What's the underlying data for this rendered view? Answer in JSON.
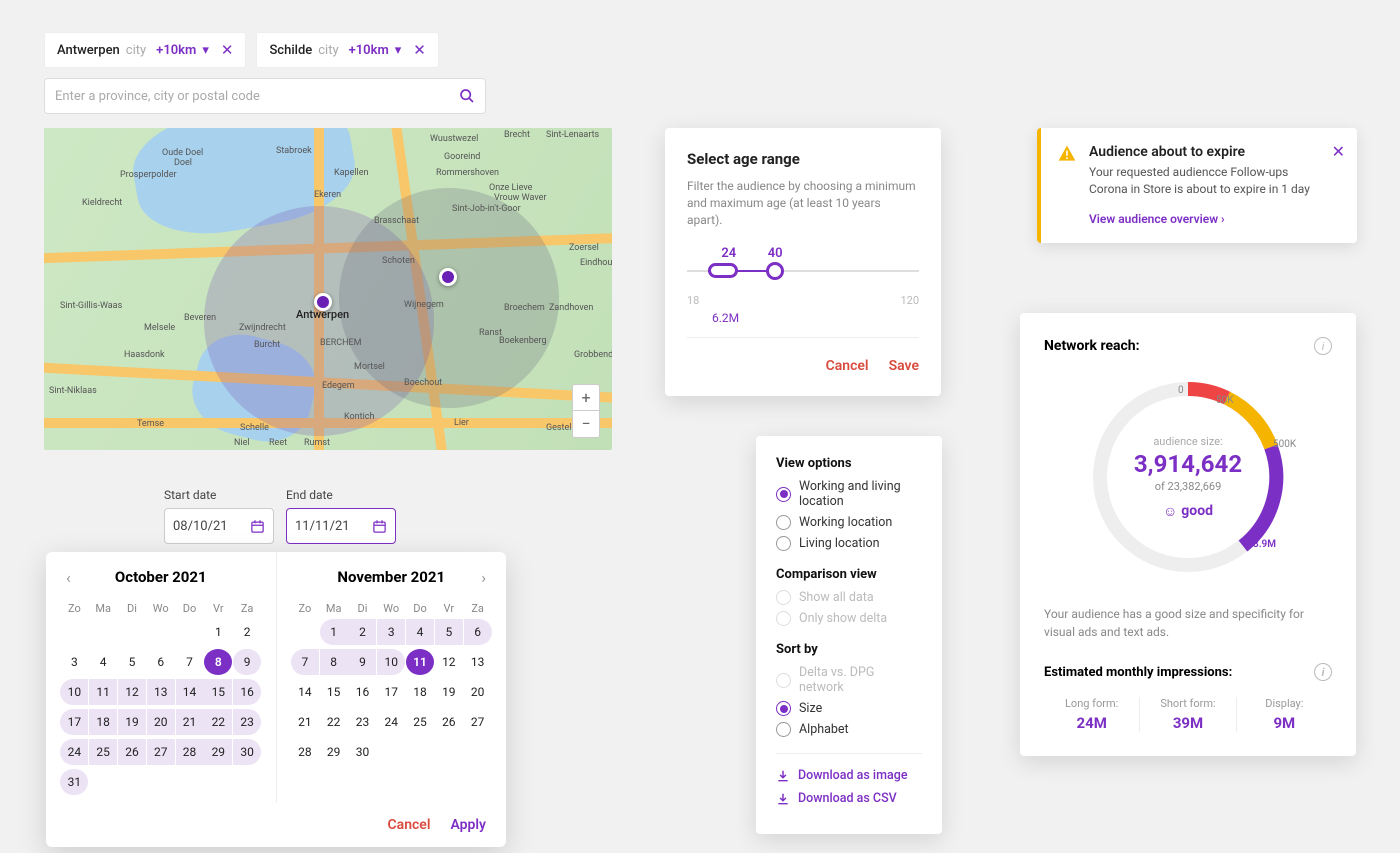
{
  "chips": [
    {
      "name": "Antwerpen",
      "type": "city",
      "radius": "+10km"
    },
    {
      "name": "Schilde",
      "type": "city",
      "radius": "+10km"
    }
  ],
  "search": {
    "placeholder": "Enter a province, city or postal code"
  },
  "map": {
    "labels": [
      "Brecht",
      "Sint-Lenaarts",
      "Brasschaat",
      "Wijnegem",
      "Ranst",
      "Edegem",
      "Mortsel",
      "Kontich",
      "Lier",
      "Gestel",
      "Zoersel",
      "Zandhoven",
      "Boechout",
      "Schoten",
      "BERCHEM",
      "Schelle",
      "Niel",
      "Reet",
      "Rumst",
      "Temse",
      "Haasdonk",
      "Zwijndrecht",
      "Burcht",
      "Beveren",
      "Sint-Niklaas",
      "Melsele",
      "Sint-Gillis-Waas",
      "Wuustwezel",
      "Gooreind",
      "Rommershoven",
      "Sint-Job-in't-Goor",
      "Stabroek",
      "Kapellen",
      "Ekeren",
      "Oude Doel",
      "Doel",
      "Prosperpolder",
      "Kieldrecht",
      "Onze Lieve",
      "Vrouw Waver",
      "Eindhout",
      "Grobbendonk",
      "Boekenberg",
      "Broechem"
    ],
    "main_city": "Antwerpen",
    "markers": [
      {
        "city": "Antwerpen",
        "radius_km": 10
      },
      {
        "city": "Schilde",
        "radius_km": 10
      }
    ]
  },
  "dates": {
    "start_label": "Start date",
    "end_label": "End date",
    "start_value": "08/10/21",
    "end_value": "11/11/21"
  },
  "calendar": {
    "prev_month": "October 2021",
    "next_month": "November 2021",
    "dow": [
      "Zo",
      "Ma",
      "Di",
      "Wo",
      "Do",
      "Vr",
      "Za"
    ],
    "oct_days": [
      [
        "",
        "",
        "",
        "",
        "",
        "1",
        "2"
      ],
      [
        "3",
        "4",
        "5",
        "6",
        "7",
        "8",
        "9"
      ],
      [
        "10",
        "11",
        "12",
        "13",
        "14",
        "15",
        "16"
      ],
      [
        "17",
        "18",
        "19",
        "20",
        "21",
        "22",
        "23"
      ],
      [
        "24",
        "25",
        "26",
        "27",
        "28",
        "29",
        "30"
      ],
      [
        "31",
        "",
        "",
        "",
        "",
        "",
        ""
      ]
    ],
    "nov_days": [
      [
        "",
        "1",
        "2",
        "3",
        "4",
        "5",
        "6"
      ],
      [
        "7",
        "8",
        "9",
        "10",
        "11",
        "12",
        "13"
      ],
      [
        "14",
        "15",
        "16",
        "17",
        "18",
        "19",
        "20"
      ],
      [
        "21",
        "22",
        "23",
        "24",
        "25",
        "26",
        "27"
      ],
      [
        "28",
        "29",
        "30",
        "",
        "",
        "",
        ""
      ]
    ],
    "selected_start": 8,
    "selected_end": 11,
    "cancel": "Cancel",
    "apply": "Apply"
  },
  "age": {
    "title": "Select age range",
    "description": "Filter the audience by choosing a minimum and maximum age (at least 10 years apart).",
    "min": "24",
    "max": "40",
    "lower_bound": "18",
    "upper_bound": "120",
    "count": "6.2M",
    "cancel": "Cancel",
    "save": "Save"
  },
  "notification": {
    "title": "Audience about to expire",
    "body": "Your requested audiencce Follow-ups Corona in Store is about to expire in 1 day",
    "link": "View audience overview"
  },
  "view_options": {
    "group1_title": "View options",
    "group1": [
      "Working and living location",
      "Working location",
      "Living location"
    ],
    "group1_selected": 0,
    "group2_title": "Comparison view",
    "group2": [
      "Show all data",
      "Only show delta"
    ],
    "group3_title": "Sort by",
    "group3": [
      "Delta vs. DPG network",
      "Size",
      "Alphabet"
    ],
    "group3_selected": 1,
    "download_image": "Download as image",
    "download_csv": "Download as CSV"
  },
  "reach": {
    "title": "Network reach:",
    "gauge_labels": {
      "zero": "0",
      "fifty": "50K",
      "fivehundred": "500K",
      "marker": "3.9M"
    },
    "center_label": "audience size:",
    "value": "3,914,642",
    "of": "of 23,382,669",
    "quality": "good",
    "description": "Your audience has a good size and specificity for visual ads and text ads.",
    "impressions_title": "Estimated monthly impressions:",
    "impressions": [
      {
        "k": "Long form:",
        "v": "24M"
      },
      {
        "k": "Short form:",
        "v": "39M"
      },
      {
        "k": "Display:",
        "v": "9M"
      }
    ]
  },
  "chart_data": {
    "type": "gauge",
    "title": "Network reach",
    "value": 3914642,
    "max": 23382669,
    "thresholds": [
      {
        "label": "0",
        "value": 0,
        "color": "#e44"
      },
      {
        "label": "50K",
        "value": 50000,
        "color": "#f5b400"
      },
      {
        "label": "500K",
        "value": 500000,
        "color": "#7c2fc4"
      },
      {
        "label": "3.9M",
        "value": 3900000,
        "color": "#ddd"
      }
    ],
    "quality": "good"
  }
}
